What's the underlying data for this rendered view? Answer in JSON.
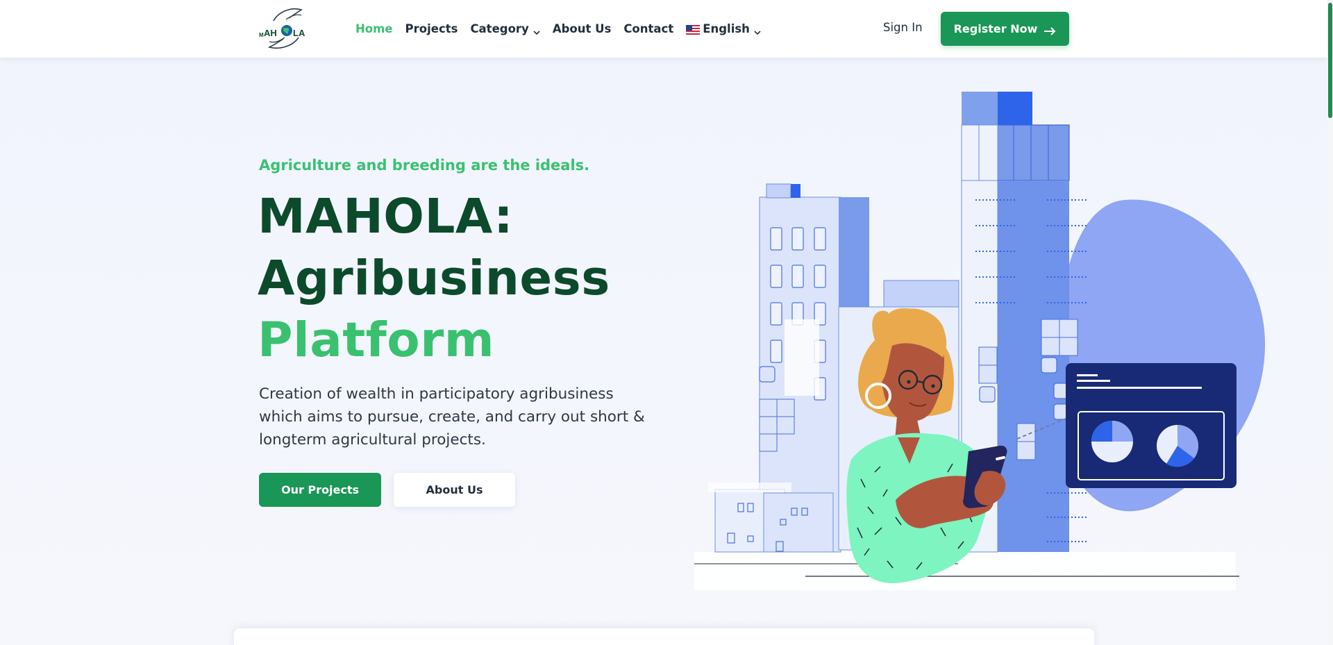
{
  "brand": {
    "logo_text": "MAHOLA",
    "primary_color": "#1a9656",
    "accent_color": "#3ac170",
    "dark_color": "#0c4a2c"
  },
  "nav": {
    "items": [
      {
        "label": "Home",
        "active": true
      },
      {
        "label": "Projects",
        "active": false
      },
      {
        "label": "Category",
        "active": false,
        "dropdown": true
      },
      {
        "label": "About Us",
        "active": false
      },
      {
        "label": "Contact",
        "active": false
      }
    ],
    "language": {
      "label": "English",
      "icon": "us-flag-icon"
    },
    "sign_in": "Sign In",
    "register": "Register Now"
  },
  "hero": {
    "tagline": "Agriculture and breeding are the ideals.",
    "title_line1": "MAHOLA:",
    "title_line2": "Agribusiness",
    "title_line3": "Platform",
    "description": "Creation of wealth in participatory agribusiness which aims to pursue, create, and carry out short & longterm agricultural projects.",
    "primary_button": "Our Projects",
    "secondary_button": "About Us"
  }
}
